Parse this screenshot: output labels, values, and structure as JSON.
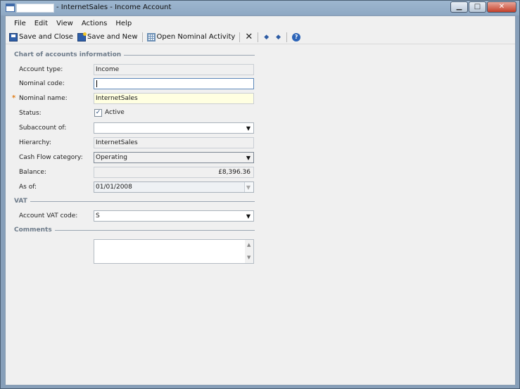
{
  "window": {
    "title": "- InternetSales - Income Account",
    "buttons": {
      "minimize": "▁",
      "maximize": "□",
      "close": "✕"
    }
  },
  "menu": [
    "File",
    "Edit",
    "View",
    "Actions",
    "Help"
  ],
  "toolbar": {
    "save_close": "Save and Close",
    "save_new": "Save and New",
    "open_nominal": "Open Nominal Activity",
    "delete_glyph": "✕",
    "prev_glyph": "◆",
    "next_glyph": "◆",
    "help_glyph": "?"
  },
  "sections": {
    "chart": "Chart of accounts information",
    "vat": "VAT",
    "comments": "Comments"
  },
  "fields": {
    "account_type": {
      "label": "Account type:",
      "value": "Income"
    },
    "nominal_code": {
      "label": "Nominal code:",
      "value": ""
    },
    "nominal_name": {
      "label": "Nominal name:",
      "value": "InternetSales",
      "required_mark": "*"
    },
    "status": {
      "label": "Status:",
      "check_label": "Active",
      "checked": "✓"
    },
    "subaccount": {
      "label": "Subaccount of:",
      "value": ""
    },
    "hierarchy": {
      "label": "Hierarchy:",
      "value": "InternetSales"
    },
    "cash_flow": {
      "label": "Cash Flow category:",
      "value": "Operating"
    },
    "balance": {
      "label": "Balance:",
      "value": "£8,396.36"
    },
    "as_of": {
      "label": "As of:",
      "value": "01/01/2008"
    },
    "account_vat": {
      "label": "Account VAT code:",
      "value": "S"
    },
    "comments": {
      "value": ""
    }
  },
  "icons": {
    "dropdown": "▼",
    "scroll_up": "▲",
    "scroll_down": "▼"
  },
  "colors": {
    "required_bg": "#ffffe1",
    "required_mark": "#e07d18",
    "section_text": "#6d7b8a"
  }
}
